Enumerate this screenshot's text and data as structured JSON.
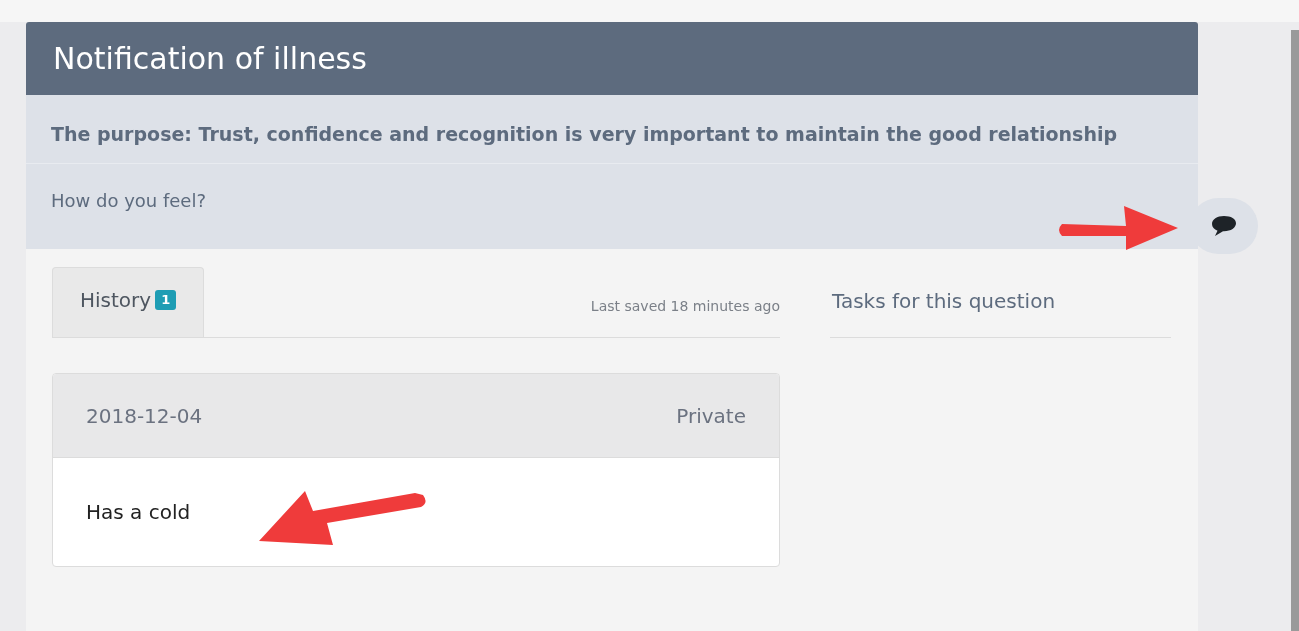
{
  "title": "Notification of illness",
  "purpose": "The purpose: Trust, confidence and recognition is very important to maintain the good relationship",
  "question": "How do you feel?",
  "tabs": [
    {
      "label": "History",
      "badge": "1",
      "selected": true
    }
  ],
  "last_saved": "Last saved 18 minutes ago",
  "tasks_heading": "Tasks for this question",
  "history": [
    {
      "date": "2018-12-04",
      "visibility": "Private",
      "text": "Has a cold"
    }
  ]
}
